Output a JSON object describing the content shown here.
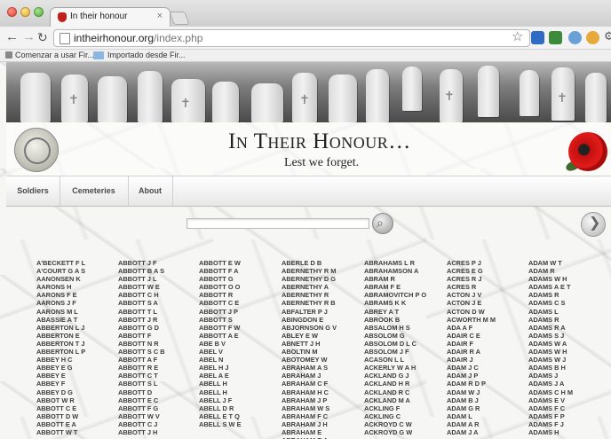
{
  "browser": {
    "tab_title": "In their honour",
    "tab_close": "×",
    "url_prefix": "intheirhonour.org",
    "url_path": "/index.php",
    "bookmarks": [
      "Comenzar a usar Fir...",
      "Importado desde Fir..."
    ],
    "icons": [
      "back-arrow-icon",
      "forward-arrow-icon",
      "reload-icon",
      "page-icon",
      "bookmark-star-icon",
      "wrench-icon"
    ]
  },
  "site": {
    "title": "In Their Honour…",
    "tagline": "Lest we forget.",
    "nav": [
      "Soldiers",
      "Cemeteries",
      "About"
    ]
  },
  "search": {
    "value": "",
    "placeholder": ""
  },
  "names": [
    [
      "A'BECKETT F L",
      "A'COURT G A S",
      "AANONSEN K",
      "AARONS H",
      "AARONS F E",
      "AARONS J F",
      "AARONS M L",
      "ABASSIE A T",
      "ABBERTON L J",
      "ABBERTON E",
      "ABBERTON T J",
      "ABBERTON L P",
      "ABBEY H C",
      "ABBEY E G",
      "ABBEY E",
      "ABBEY F",
      "ABBEY D G",
      "ABBOT W R",
      "ABBOTT C E",
      "ABBOTT D W",
      "ABBOTT E A",
      "ABBOTT W T"
    ],
    [
      "ABBOTT J F",
      "ABBOTT B A S",
      "ABBOTT J L",
      "ABBOTT W E",
      "ABBOTT C H",
      "ABBOTT S A",
      "ABBOTT T L",
      "ABBOTT J R",
      "ABBOTT G D",
      "ABBOTT F",
      "ABBOTT N R",
      "ABBOTT S C B",
      "ABBOTT A F",
      "ABBOTT R E",
      "ABBOTT C T",
      "ABBOTT S L",
      "ABBOTT D",
      "ABBOTT E C",
      "ABBOTT F G",
      "ABBOTT W V",
      "ABBOTT C J",
      "ABBOTT J H"
    ],
    [
      "ABBOTT E W",
      "ABBOTT F A",
      "ABBOTT G",
      "ABBOTT O O",
      "ABBOTT R",
      "ABBOTT C E",
      "ABBOTT J P",
      "ABBOTT S",
      "ABBOTT F W",
      "ABBOTT A E",
      "ABE B V",
      "ABEL V",
      "ABEL N",
      "ABEL H J",
      "ABEL A E",
      "ABELL H",
      "ABELL H",
      "ABELL J F",
      "ABELL D R",
      "ABELL E T Q",
      "ABELL S W E"
    ],
    [
      "ABERLE D B",
      "ABERNETHY R M",
      "ABERNETHY D G",
      "ABERNETHY A",
      "ABERNETHY R",
      "ABERNETHY R B",
      "ABFALTER P J",
      "ABINGDON E",
      "ABJORNSON G V",
      "ABLEY E W",
      "ABNETT J H",
      "ABOLTIN M",
      "ABOTOMEY W",
      "ABRAHAM A S",
      "ABRAHAM J",
      "ABRAHAM C F",
      "ABRAHAM H C",
      "ABRAHAM J P",
      "ABRAHAM W S",
      "ABRAHAM F C",
      "ABRAHAM J H",
      "ABRAHAM E",
      "ABRAHAM E A"
    ],
    [
      "ABRAHAMS L R",
      "ABRAHAMSON A",
      "ABRAM R",
      "ABRAM F E",
      "ABRAMOVITCH P O",
      "ABRAMS K K",
      "ABREY A T",
      "ABROOK B",
      "ABSALOM H S",
      "ABSOLOM G",
      "ABSOLOM D L C",
      "ABSOLOM J F",
      "ACASON L L",
      "ACKERLY W A H",
      "ACKLAND G J",
      "ACKLAND H R",
      "ACKLAND R C",
      "ACKLAND M A",
      "ACKLING F",
      "ACKLING C",
      "ACKROYD C W",
      "ACKROYD G W"
    ],
    [
      "ACRES P J",
      "ACRES E G",
      "ACRES R J",
      "ACRES R",
      "ACTON J V",
      "ACTON J E",
      "ACTON D W",
      "ACWORTH M M",
      "ADA A F",
      "ADAIR C E",
      "ADAIR F",
      "ADAIR R A",
      "ADAIR J",
      "ADAM J C",
      "ADAM J P",
      "ADAM R D P",
      "ADAM W J",
      "ADAM B J",
      "ADAM G R",
      "ADAM L",
      "ADAM A R",
      "ADAM J A"
    ],
    [
      "ADAM W T",
      "ADAM R",
      "ADAMS W H",
      "ADAMS A E T",
      "ADAMS R",
      "ADAMS C S",
      "ADAMS L",
      "ADAMS R",
      "ADAMS R A",
      "ADAMS S J",
      "ADAMS W A",
      "ADAMS W H",
      "ADAMS W J",
      "ADAMS B H",
      "ADAMS J",
      "ADAMS J A",
      "ADAMS C H M",
      "ADAMS E V",
      "ADAMS F C",
      "ADAMS F P",
      "ADAMS F J",
      "ADAMS H"
    ]
  ]
}
